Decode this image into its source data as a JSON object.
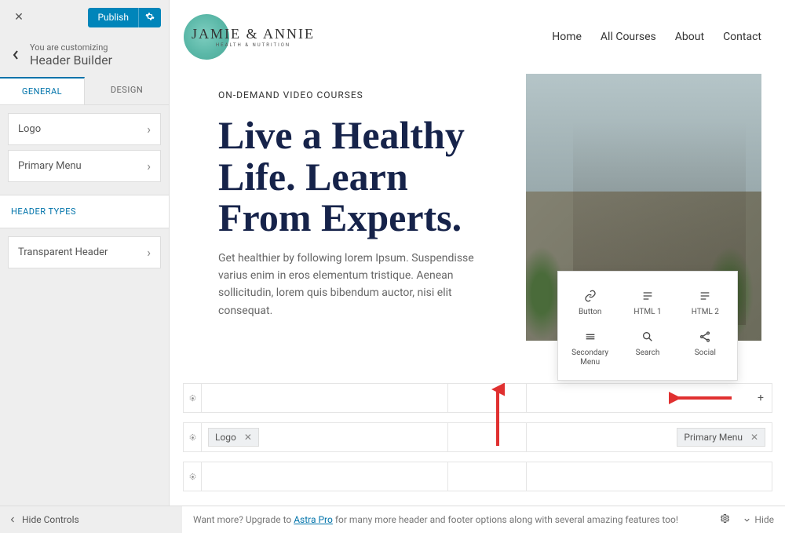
{
  "sidebar": {
    "publish_label": "Publish",
    "breadcrumb_small": "You are customizing",
    "breadcrumb_title": "Header Builder",
    "tabs": {
      "general": "GENERAL",
      "design": "DESIGN"
    },
    "rows": {
      "logo": "Logo",
      "primary_menu": "Primary Menu"
    },
    "section_types": "HEADER TYPES",
    "transparent": "Transparent Header"
  },
  "nav": {
    "brand_main": "JAMIE & ANNIE",
    "brand_sub": "HEALTH & NUTRITION",
    "items": [
      "Home",
      "All Courses",
      "About",
      "Contact"
    ]
  },
  "hero": {
    "eyebrow": "ON-DEMAND VIDEO COURSES",
    "title": "Live a Healthy Life. Learn From Experts.",
    "body": "Get healthier by following lorem Ipsum. Suspendisse varius enim in eros elementum tristique. Aenean sollicitudin, lorem quis bibendum auctor, nisi elit consequat."
  },
  "popup": {
    "items": [
      {
        "label": "Button",
        "icon": "link-icon"
      },
      {
        "label": "HTML 1",
        "icon": "html-icon"
      },
      {
        "label": "HTML 2",
        "icon": "html-icon"
      },
      {
        "label": "Secondary Menu",
        "icon": "menu-icon"
      },
      {
        "label": "Search",
        "icon": "search-icon"
      },
      {
        "label": "Social",
        "icon": "share-icon"
      }
    ]
  },
  "builder": {
    "logo_chip": "Logo",
    "menu_chip": "Primary Menu"
  },
  "bottom": {
    "hide_controls": "Hide Controls",
    "promo_pre": "Want more? Upgrade to ",
    "promo_link": "Astra Pro",
    "promo_post": " for many more header and footer options along with several amazing features too!",
    "hide": "Hide"
  }
}
